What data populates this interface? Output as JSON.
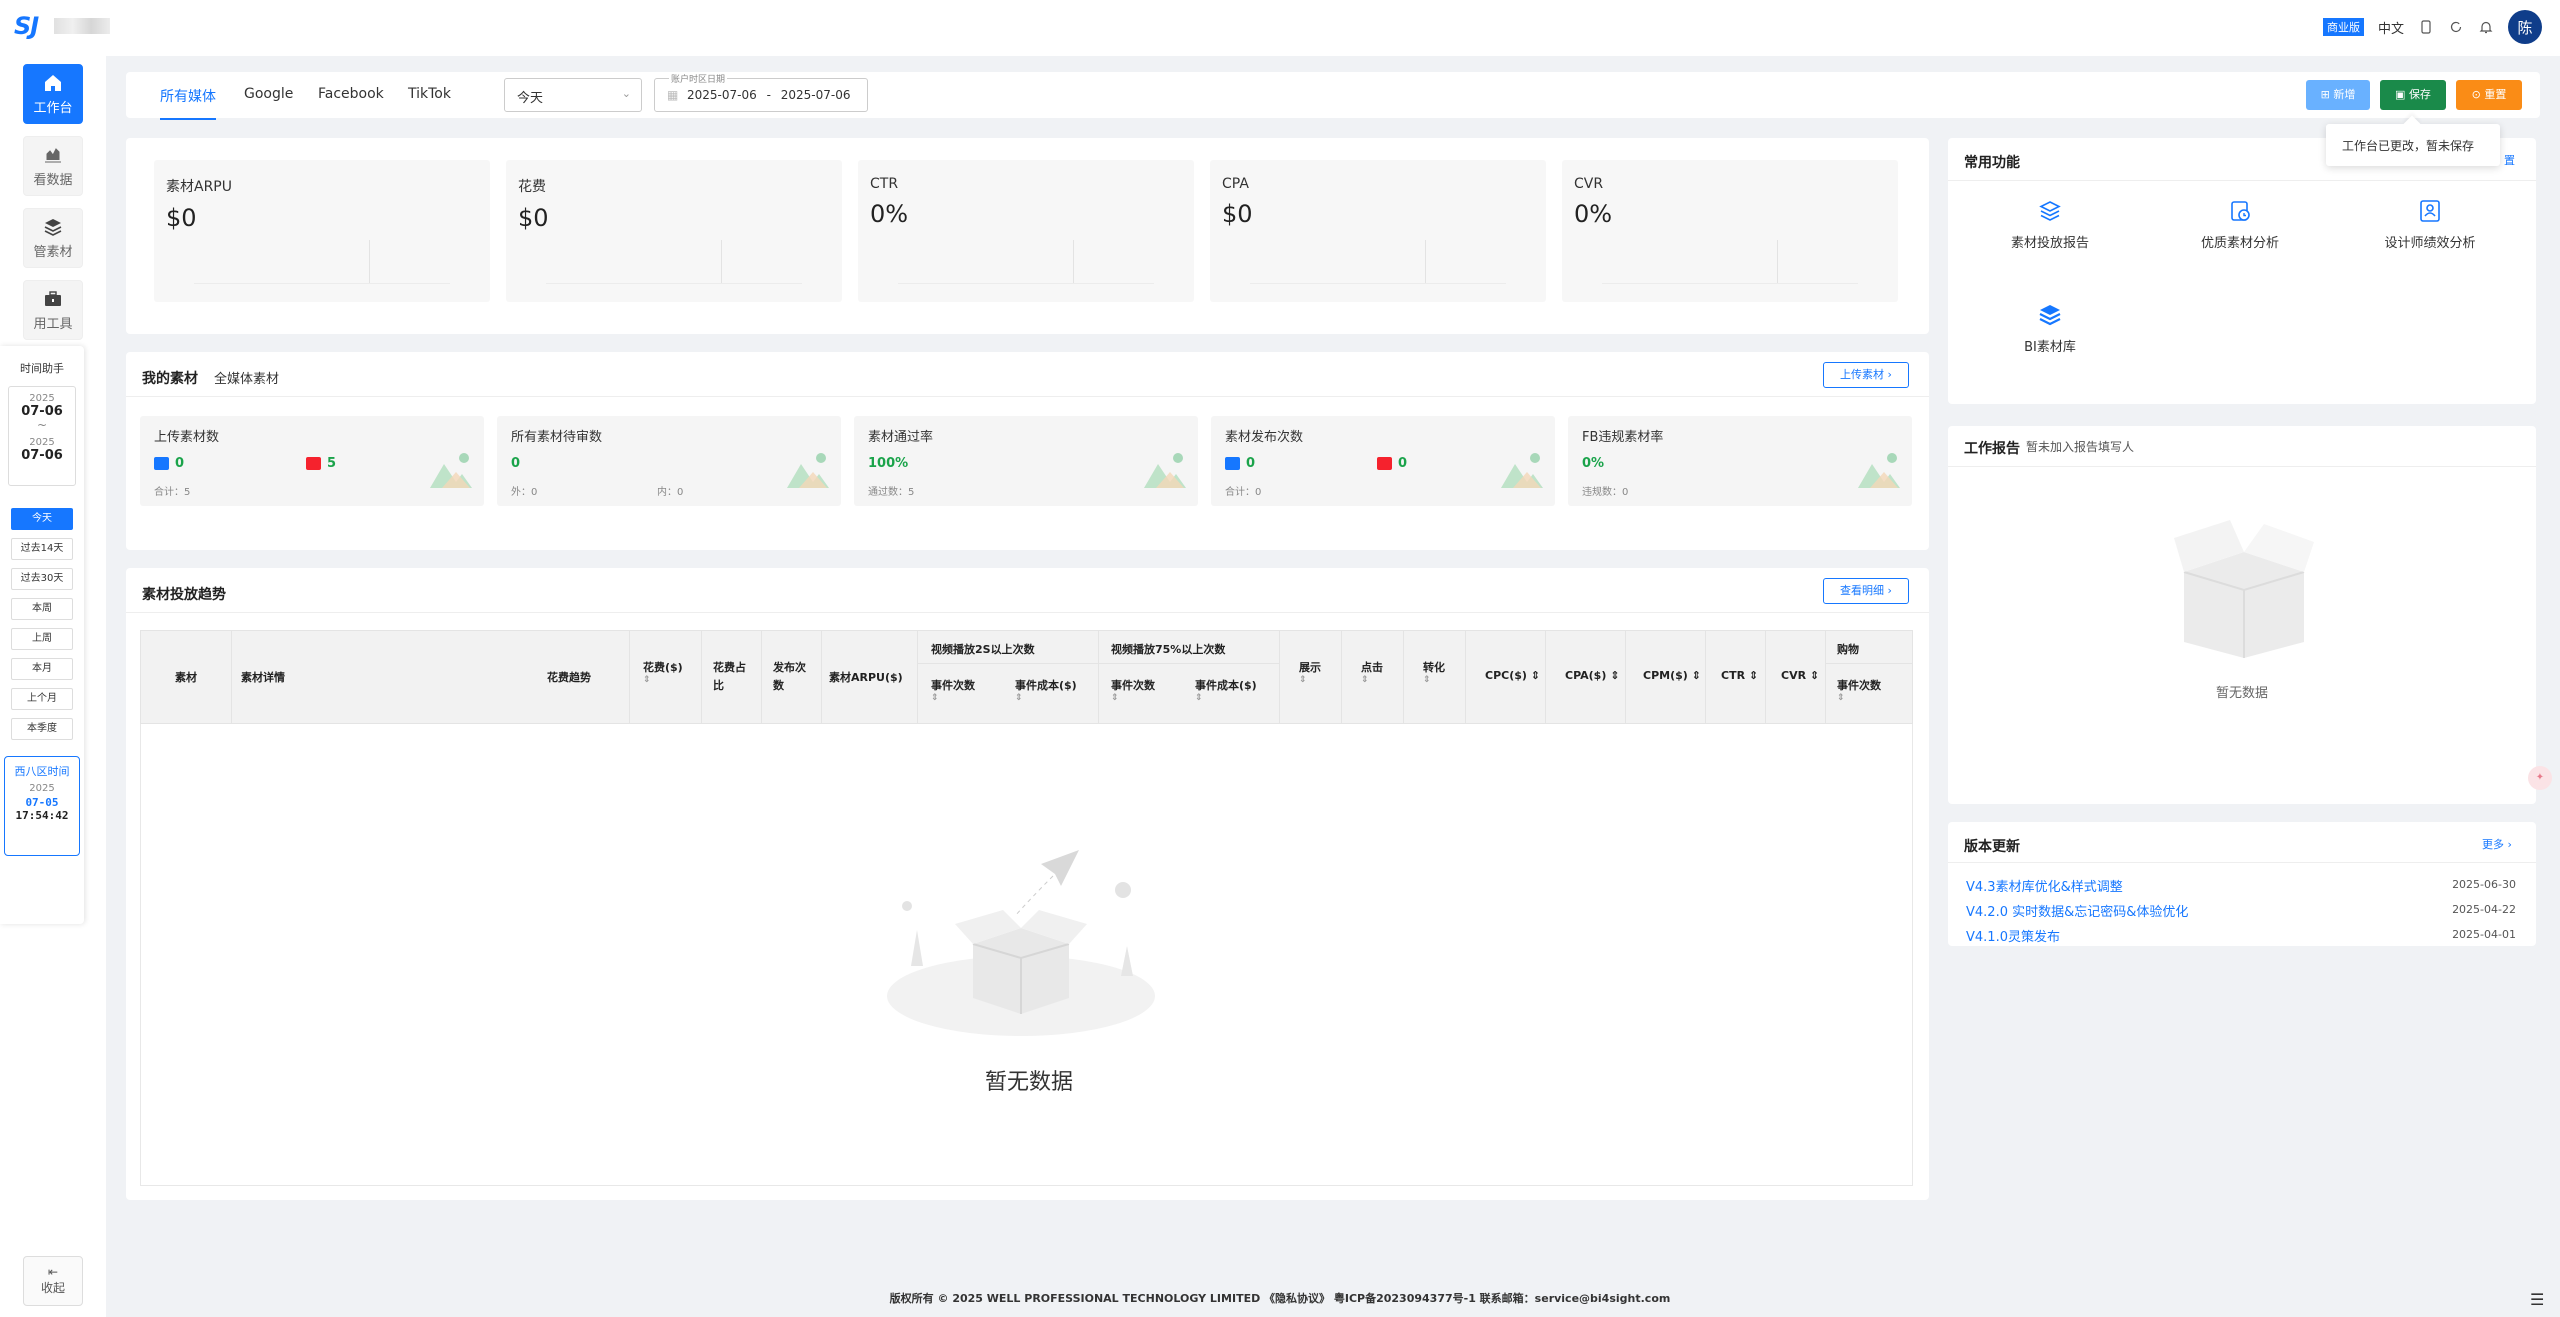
{
  "header": {
    "logo_text": "SJ",
    "biz_badge": "商业版",
    "language": "中文",
    "user_avatar": "陈",
    "icons": [
      "mobile-icon",
      "refresh-icon",
      "bell-icon"
    ]
  },
  "sidebar": {
    "items": [
      {
        "label": "工作台",
        "icon": "home-icon",
        "active": true
      },
      {
        "label": "看数据",
        "icon": "chart-icon"
      },
      {
        "label": "管素材",
        "icon": "layers-icon"
      },
      {
        "label": "用工具",
        "icon": "toolbox-icon"
      }
    ],
    "time_helper": {
      "title": "时间助手",
      "start_year": "2025",
      "start_date": "07-06",
      "sep": "~",
      "end_year": "2025",
      "end_date": "07-06",
      "buttons": [
        "今天",
        "过去14天",
        "过去30天",
        "本周",
        "上周",
        "本月",
        "上个月",
        "本季度"
      ],
      "active_button": "今天",
      "tz_name": "西八区时间",
      "tz_year": "2025",
      "tz_date": "07-05",
      "tz_time": "17:54:42"
    },
    "collapse_label": "收起"
  },
  "filterbar": {
    "tabs": [
      "所有媒体",
      "Google",
      "Facebook",
      "TikTok"
    ],
    "active_tab": "所有媒体",
    "period_select": "今天",
    "date_label": "账户时区日期",
    "date_start": "2025-07-06",
    "date_sep": "-",
    "date_end": "2025-07-06",
    "btn_add": "新增",
    "btn_save": "保存",
    "btn_reset": "重置",
    "tooltip": "工作台已更改，暂未保存"
  },
  "kpis": [
    {
      "name": "素材ARPU",
      "value": "$0"
    },
    {
      "name": "花费",
      "value": "$0"
    },
    {
      "name": "CTR",
      "value": "0%"
    },
    {
      "name": "CPA",
      "value": "$0"
    },
    {
      "name": "CVR",
      "value": "0%"
    }
  ],
  "my_material": {
    "title": "我的素材",
    "sub": "全媒体素材",
    "upload_btn": "上传素材",
    "cards": [
      {
        "name": "上传素材数",
        "a": "0",
        "b": "5",
        "foot": "合计：5",
        "foot2": ""
      },
      {
        "name": "所有素材待审数",
        "a": "0",
        "b": "",
        "foot": "外：0",
        "foot2": "内：0"
      },
      {
        "name": "素材通过率",
        "a": "100%",
        "b": "",
        "foot": "通过数：5",
        "foot2": ""
      },
      {
        "name": "素材发布次数",
        "a": "0",
        "b": "0",
        "foot": "合计：0",
        "foot2": ""
      },
      {
        "name": "FB违规素材率",
        "a": "0%",
        "b": "",
        "foot": "违规数：0",
        "foot2": ""
      }
    ]
  },
  "trend": {
    "title": "素材投放趋势",
    "detail_btn": "查看明细",
    "columns": {
      "material": "素材",
      "detail": "素材详情",
      "spend_trend": "花费趋势",
      "spend": "花费($)",
      "spend_ratio": "花费占比",
      "publish": "发布次数",
      "arpu": "素材ARPU($)",
      "video2s": "视频播放2S以上次数",
      "video75": "视频播放75%以上次数",
      "event_count": "事件次数",
      "event_cost": "事件成本($)",
      "impressions": "展示",
      "clicks": "点击",
      "conversions": "转化",
      "cpc": "CPC($)",
      "cpa": "CPA($)",
      "cpm": "CPM($)",
      "ctr": "CTR",
      "cvr": "CVR",
      "shopping": "购物"
    },
    "empty": "暂无数据"
  },
  "common_funcs": {
    "title": "常用功能",
    "items": [
      {
        "label": "素材投放报告",
        "icon": "stack-icon"
      },
      {
        "label": "优质素材分析",
        "icon": "clipboard-clock-icon"
      },
      {
        "label": "设计师绩效分析",
        "icon": "person-card-icon"
      },
      {
        "label": "BI素材库",
        "icon": "stack-filled-icon"
      }
    ]
  },
  "work_report": {
    "title": "工作报告",
    "sub": "暂未加入报告填写人",
    "empty": "暂无数据"
  },
  "versions": {
    "title": "版本更新",
    "more": "更多",
    "items": [
      {
        "title": "V4.3素材库优化&样式调整",
        "date": "2025-06-30"
      },
      {
        "title": "V4.2.0 实时数据&忘记密码&体验优化",
        "date": "2025-04-22"
      },
      {
        "title": "V4.1.0灵策发布",
        "date": "2025-04-01"
      }
    ]
  },
  "footer": "版权所有 © 2025 WELL PROFESSIONAL TECHNOLOGY LIMITED 《隐私协议》 粤ICP备2023094377号-1 联系邮箱：service@bi4sight.com",
  "colors": {
    "primary": "#1677ff",
    "save": "#1a8a4a",
    "reset": "#fa8c16",
    "add": "#69b1ff"
  }
}
